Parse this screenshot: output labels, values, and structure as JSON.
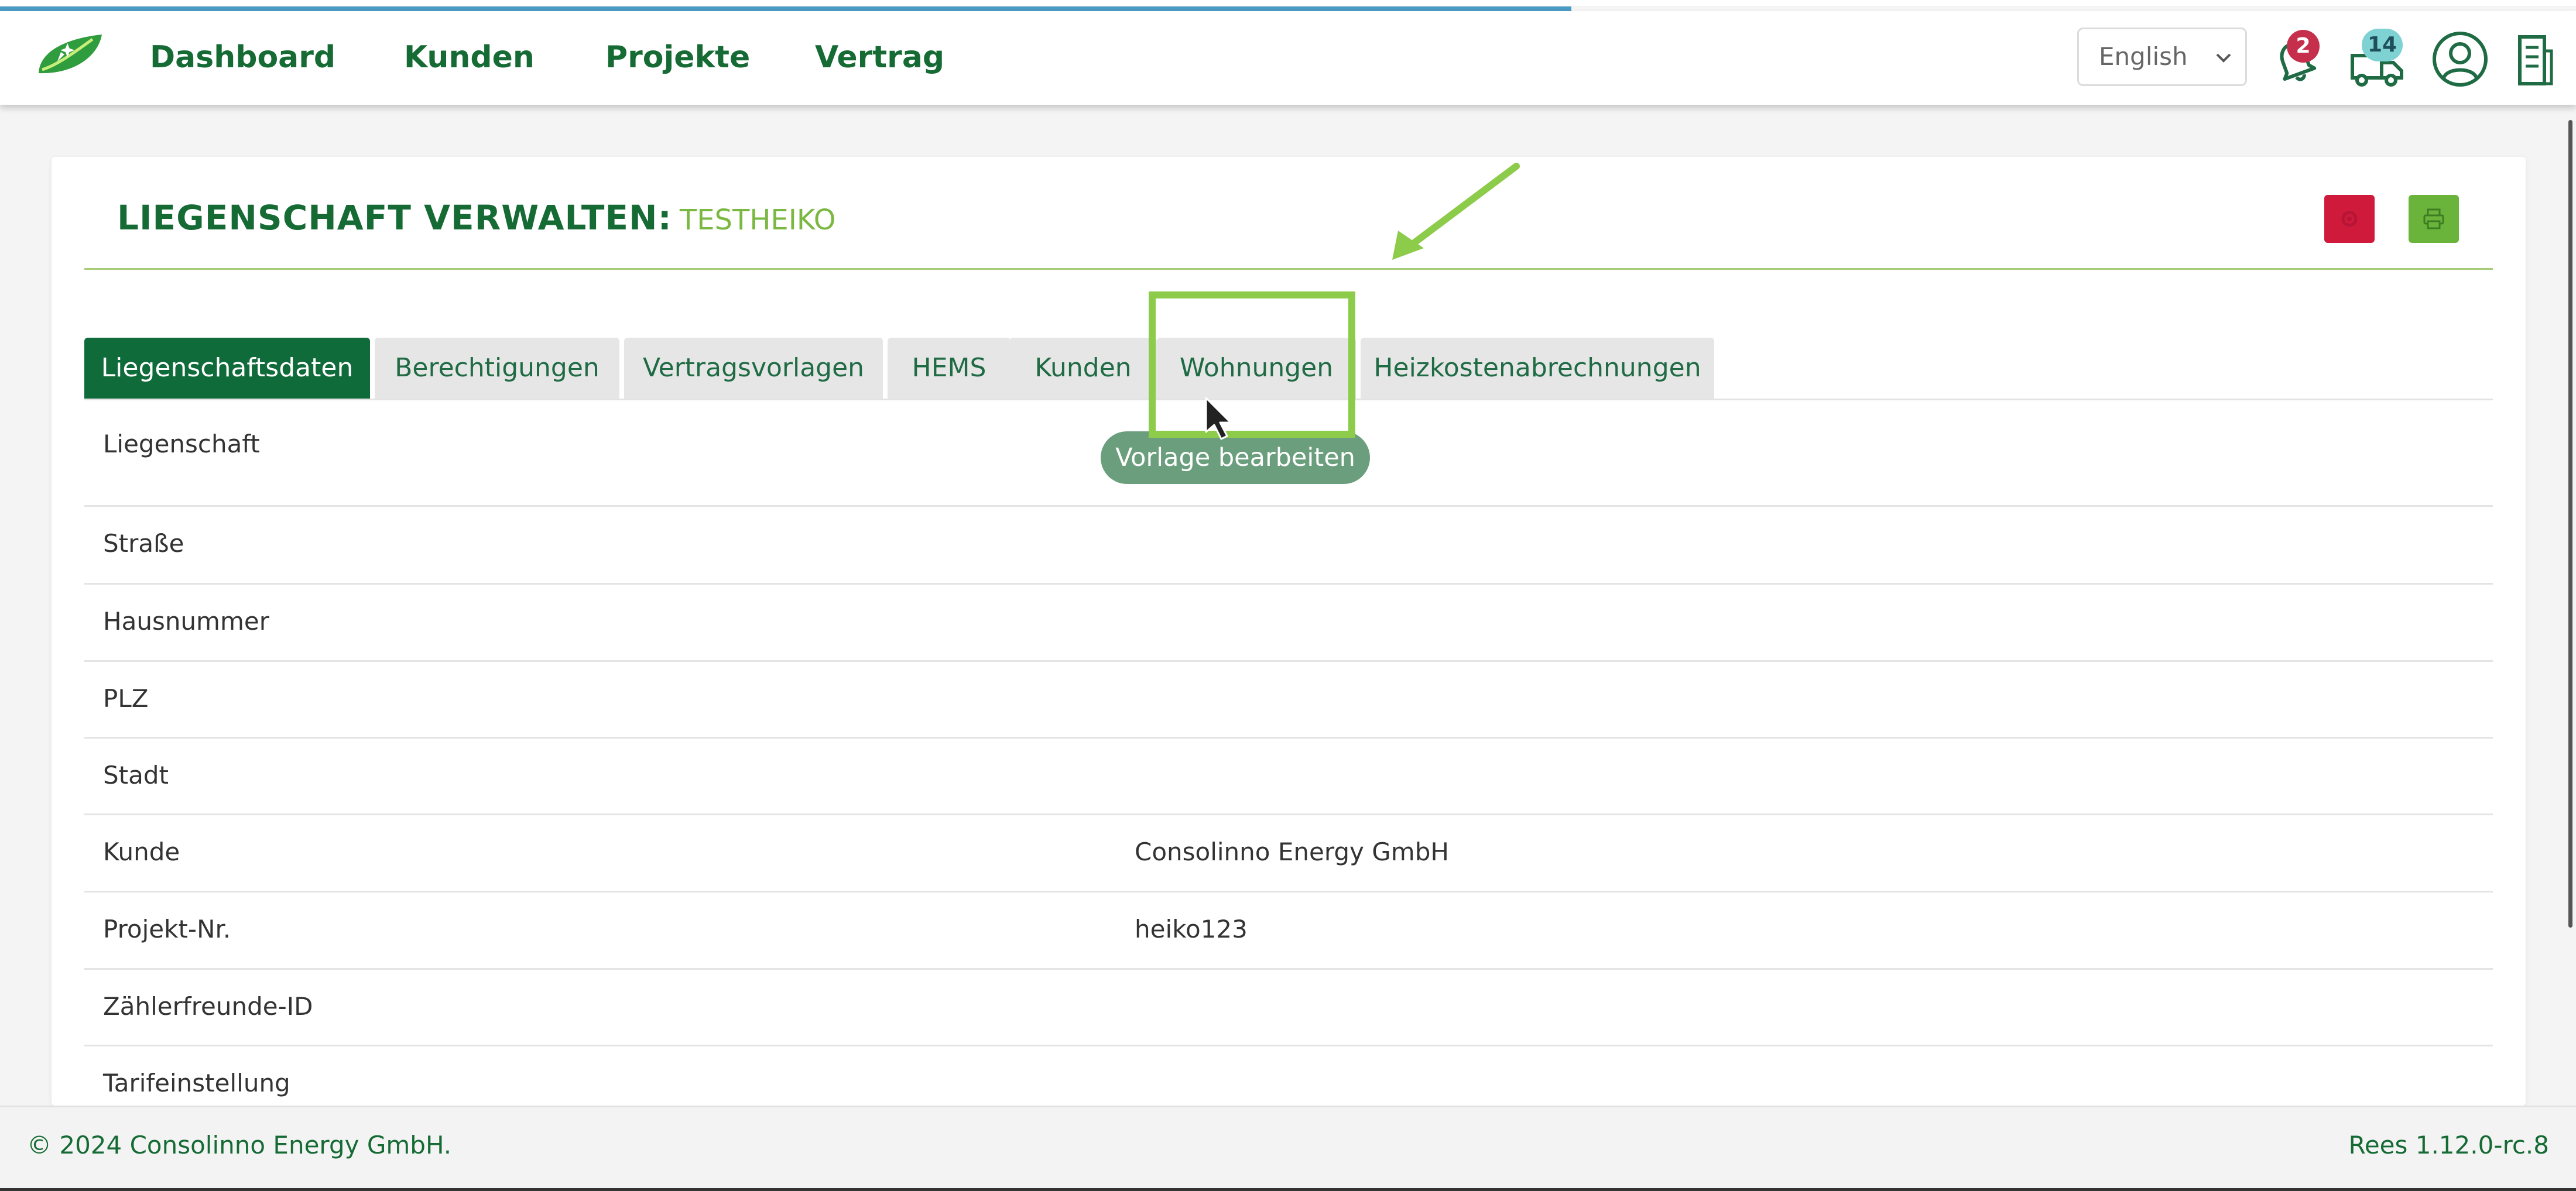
{
  "header": {
    "nav": [
      "Dashboard",
      "Kunden",
      "Projekte",
      "Vertrag"
    ],
    "language": "English",
    "notifications_count": "2",
    "news_count": "14",
    "brand_green": "#166b35",
    "badge_red": "#c62f4b",
    "badge_teal": "#7fd2d4"
  },
  "page": {
    "title": "LIEGENSCHAFT VERWALTEN:",
    "subtitle": "TESTHEIKO",
    "loading_progress": 0.61
  },
  "tabs": [
    "Liegenschaftsdaten",
    "Berechtigungen",
    "Vertragsvorlagen",
    "HEMS",
    "Kunden",
    "Wohnungen",
    "Heizkostenabrechnungen"
  ],
  "active_tab": "Liegenschaftsdaten",
  "tooltip": "Vorlage bearbeiten",
  "rows": [
    {
      "label": "Liegenschaft",
      "value": ""
    },
    {
      "label": "Straße",
      "value": ""
    },
    {
      "label": "Hausnummer",
      "value": ""
    },
    {
      "label": "PLZ",
      "value": ""
    },
    {
      "label": "Stadt",
      "value": ""
    },
    {
      "label": "Kunde",
      "value": "Consolinno Energy GmbH"
    },
    {
      "label": "Projekt-Nr.",
      "value": "heiko123"
    },
    {
      "label": "Zählerfreunde-ID",
      "value": ""
    },
    {
      "label": "Tarifeinstellung",
      "value": ""
    }
  ],
  "footer": {
    "copyright": "© 2024 Consolinno Energy GmbH.",
    "version": "Rees 1.12.0-rc.8"
  },
  "icons": {
    "logo": "leaf-logo-icon",
    "notifications": "bell-icon",
    "news": "news-truck-icon",
    "profile": "user-icon",
    "building": "building-icon",
    "settings": "gear-icon",
    "print": "printer-icon",
    "lang_chevron": "chevron-down-icon"
  }
}
